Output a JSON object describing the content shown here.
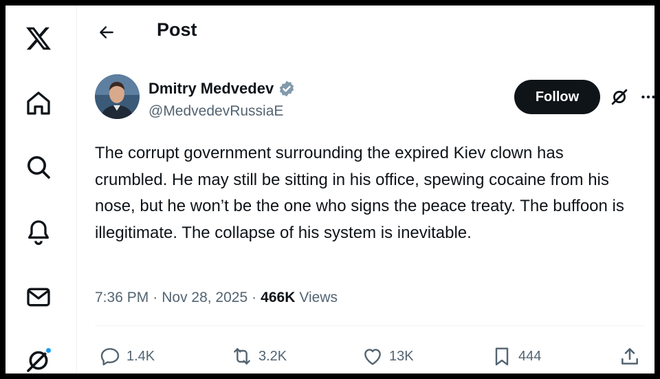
{
  "nav": {
    "icons": [
      "x-logo-icon",
      "home-icon",
      "search-icon",
      "notifications-icon",
      "messages-icon",
      "grok-icon"
    ]
  },
  "header": {
    "title": "Post"
  },
  "post": {
    "author_name": "Dmitry Medvedev",
    "author_handle": "@MedvedevRussiaE",
    "follow_label": "Follow",
    "text": "The corrupt government surrounding the expired Kiev clown has crumbled. He may still be sitting in his office, spewing cocaine from his nose, but he won’t be the one who signs the peace treaty. The buffoon is illegitimate. The collapse of his system is inevitable.",
    "time": "7:36 PM",
    "date": "Nov 28, 2025",
    "dot": "·",
    "views_count": "466K",
    "views_label": "Views"
  },
  "actions": {
    "replies": "1.4K",
    "reposts": "3.2K",
    "likes": "13K",
    "bookmarks": "444"
  },
  "colors": {
    "text": "#0f1419",
    "secondary": "#536471",
    "accent": "#1d9bf0",
    "verified_badge": "#829aab",
    "follow_bg": "#0f1419"
  }
}
